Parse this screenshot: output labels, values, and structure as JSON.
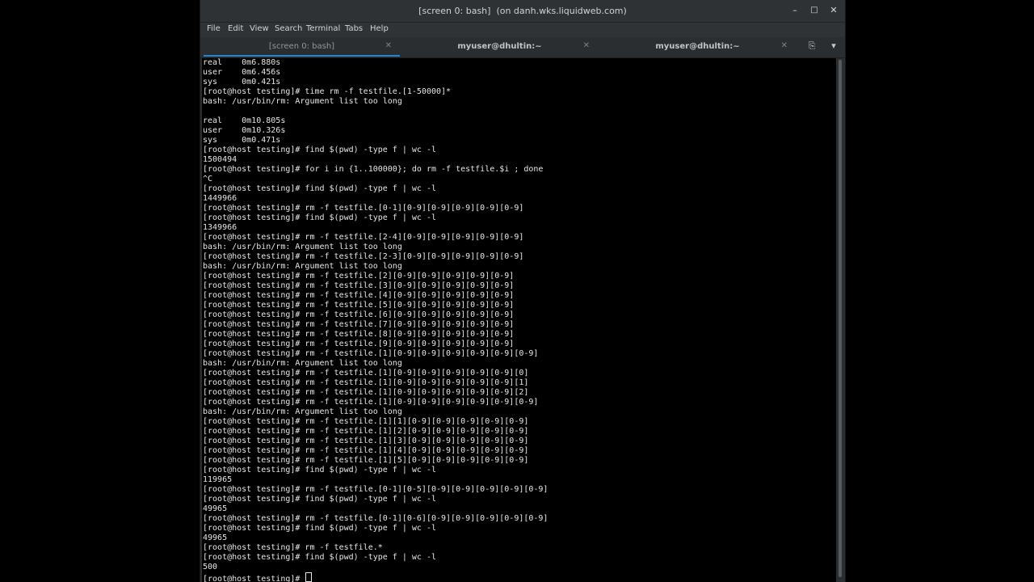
{
  "window": {
    "title": "[screen 0: bash]  (on danh.wks.liquidweb.com)",
    "minimize": "–",
    "maximize": "□",
    "close": "✕"
  },
  "menu": [
    "File",
    "Edit",
    "View",
    "Search",
    "Terminal",
    "Tabs",
    "Help"
  ],
  "tabs": [
    {
      "label": "[screen 0: bash]",
      "close": "✕"
    },
    {
      "label": "myuser@dhultin:~",
      "close": "✕"
    },
    {
      "label": "myuser@dhultin:~",
      "close": "✕"
    }
  ],
  "tab_icons": {
    "new_tab": "⎘",
    "dropdown": "▾"
  },
  "terminal": {
    "lines": [
      "real    0m6.880s",
      "user    0m6.456s",
      "sys     0m0.421s",
      "[root@host testing]# time rm -f testfile.[1-50000]*",
      "bash: /usr/bin/rm: Argument list too long",
      "",
      "real    0m10.805s",
      "user    0m10.326s",
      "sys     0m0.471s",
      "[root@host testing]# find $(pwd) -type f | wc -l",
      "1500494",
      "[root@host testing]# for i in {1..100000}; do rm -f testfile.$i ; done",
      "^C",
      "[root@host testing]# find $(pwd) -type f | wc -l",
      "1449966",
      "[root@host testing]# rm -f testfile.[0-1][0-9][0-9][0-9][0-9][0-9]",
      "[root@host testing]# find $(pwd) -type f | wc -l",
      "1349966",
      "[root@host testing]# rm -f testfile.[2-4][0-9][0-9][0-9][0-9][0-9]",
      "bash: /usr/bin/rm: Argument list too long",
      "[root@host testing]# rm -f testfile.[2-3][0-9][0-9][0-9][0-9][0-9]",
      "bash: /usr/bin/rm: Argument list too long",
      "[root@host testing]# rm -f testfile.[2][0-9][0-9][0-9][0-9][0-9]",
      "[root@host testing]# rm -f testfile.[3][0-9][0-9][0-9][0-9][0-9]",
      "[root@host testing]# rm -f testfile.[4][0-9][0-9][0-9][0-9][0-9]",
      "[root@host testing]# rm -f testfile.[5][0-9][0-9][0-9][0-9][0-9]",
      "[root@host testing]# rm -f testfile.[6][0-9][0-9][0-9][0-9][0-9]",
      "[root@host testing]# rm -f testfile.[7][0-9][0-9][0-9][0-9][0-9]",
      "[root@host testing]# rm -f testfile.[8][0-9][0-9][0-9][0-9][0-9]",
      "[root@host testing]# rm -f testfile.[9][0-9][0-9][0-9][0-9][0-9]",
      "[root@host testing]# rm -f testfile.[1][0-9][0-9][0-9][0-9][0-9][0-9]",
      "bash: /usr/bin/rm: Argument list too long",
      "[root@host testing]# rm -f testfile.[1][0-9][0-9][0-9][0-9][0-9][0]",
      "[root@host testing]# rm -f testfile.[1][0-9][0-9][0-9][0-9][0-9][1]",
      "[root@host testing]# rm -f testfile.[1][0-9][0-9][0-9][0-9][0-9][2]",
      "[root@host testing]# rm -f testfile.[1][0-9][0-9][0-9][0-9][0-9][0-9]",
      "bash: /usr/bin/rm: Argument list too long",
      "[root@host testing]# rm -f testfile.[1][1][0-9][0-9][0-9][0-9][0-9]",
      "[root@host testing]# rm -f testfile.[1][2][0-9][0-9][0-9][0-9][0-9]",
      "[root@host testing]# rm -f testfile.[1][3][0-9][0-9][0-9][0-9][0-9]",
      "[root@host testing]# rm -f testfile.[1][4][0-9][0-9][0-9][0-9][0-9]",
      "[root@host testing]# rm -f testfile.[1][5][0-9][0-9][0-9][0-9][0-9]",
      "[root@host testing]# find $(pwd) -type f | wc -l",
      "119965",
      "[root@host testing]# rm -f testfile.[0-1][0-5][0-9][0-9][0-9][0-9][0-9]",
      "[root@host testing]# find $(pwd) -type f | wc -l",
      "49965",
      "[root@host testing]# rm -f testfile.[0-1][0-6][0-9][0-9][0-9][0-9][0-9]",
      "[root@host testing]# find $(pwd) -type f | wc -l",
      "49965",
      "[root@host testing]# rm -f testfile.*",
      "[root@host testing]# find $(pwd) -type f | wc -l",
      "500"
    ],
    "prompt": "[root@host testing]# "
  }
}
